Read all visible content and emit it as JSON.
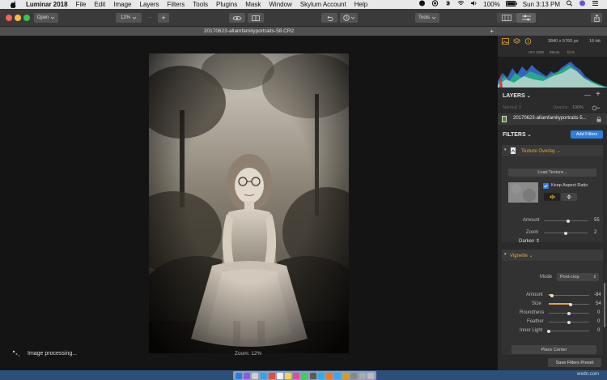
{
  "menubar": {
    "app_name": "Luminar 2018",
    "items": [
      "File",
      "Edit",
      "Image",
      "Layers",
      "Filters",
      "Tools",
      "Plugins",
      "Mask",
      "Window",
      "Skylum Account",
      "Help"
    ],
    "battery": "100%",
    "clock": "Sun 3:13 PM"
  },
  "toolbar": {
    "open_label": "Open",
    "zoom_label": "12%",
    "zoom_dots": "···",
    "zoom_plus": "+",
    "tools_label": "Tools"
  },
  "document": {
    "title": "20170623-allamfamilyportraits-58.CR2",
    "tab_plus": "+",
    "zoom_status": "Zoom: 12%",
    "processing_text": "Image processing..."
  },
  "info": {
    "dimensions": "3840 x 5760 px",
    "bit_depth": "16-bit",
    "iso": "ISO 1000",
    "focal": "85mm",
    "aperture": "f/4.5"
  },
  "layers": {
    "header": "LAYERS",
    "blend_mode": "Normal",
    "opacity_label": "Opacity:",
    "opacity_value": "100%",
    "layer_name": "20170623-allamfamilyportraits-5..."
  },
  "filters": {
    "header": "FILTERS",
    "add_button": "Add Filters",
    "texture_overlay": {
      "title": "Texture Overlay",
      "load_button": "Load Texture...",
      "keep_aspect_label": "Keep Aspect Ratio",
      "keep_aspect_checked": true,
      "amount_label": "Amount",
      "amount_value": "55",
      "amount_fraction": 0.55,
      "zoom_label": "Zoom",
      "zoom_value": "2",
      "zoom_fraction": 0.5,
      "blend_label": "Darken"
    },
    "vignette": {
      "title": "Vignette",
      "mode_label": "Mode",
      "mode_value": "Post-crop",
      "amount_label": "Amount",
      "amount_value": "-84",
      "size_label": "Size",
      "size_value": "54",
      "roundness_label": "Roundness",
      "roundness_value": "0",
      "feather_label": "Feather",
      "feather_value": "0",
      "inner_light_label": "Inner Light",
      "inner_light_value": "0",
      "place_center_button": "Place Center"
    },
    "save_preset_button": "Save Filters Preset"
  },
  "watermark": "wxdn.com",
  "colors": {
    "accent_blue": "#2f7fdc",
    "accent_orange": "#e8a33c",
    "panel_bg": "#2b2b2b",
    "canvas_bg": "#141414"
  }
}
